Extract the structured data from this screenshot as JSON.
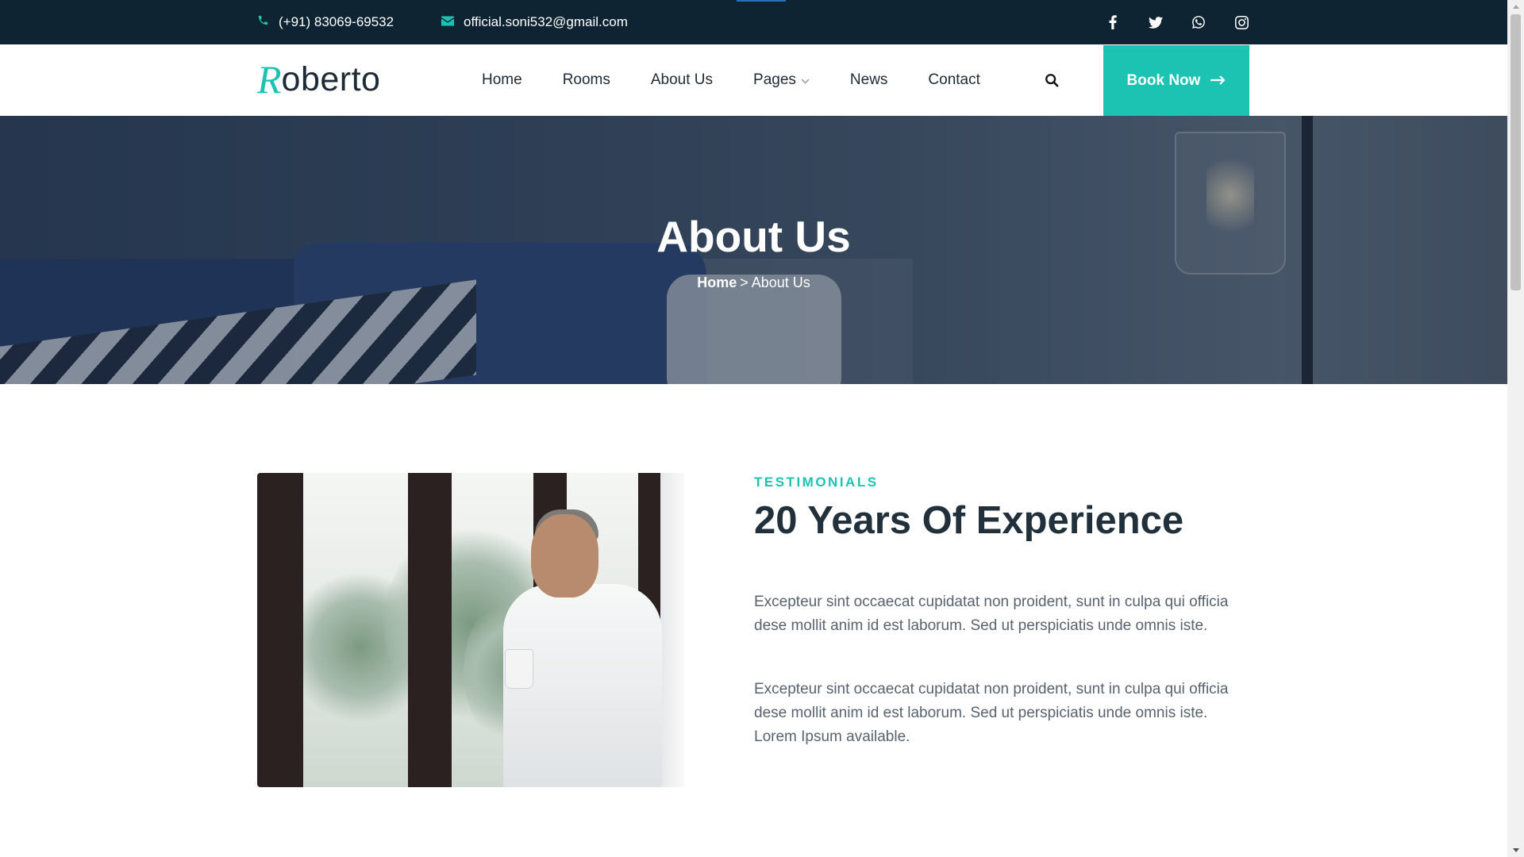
{
  "topbar": {
    "phone": "(+91) 83069-69532",
    "email": "official.soni532@gmail.com",
    "socials": [
      "facebook-icon",
      "twitter-icon",
      "whatsapp-icon",
      "instagram-icon"
    ]
  },
  "brand": {
    "logo_initial": "R",
    "logo_rest": "oberto"
  },
  "nav": {
    "items": [
      {
        "label": "Home"
      },
      {
        "label": "Rooms"
      },
      {
        "label": "About Us"
      },
      {
        "label": "Pages"
      },
      {
        "label": "News"
      },
      {
        "label": "Contact"
      }
    ],
    "book_label": "Book Now"
  },
  "hero": {
    "title": "About Us",
    "breadcrumb_home": "Home",
    "breadcrumb_sep": ">",
    "breadcrumb_current": "About Us"
  },
  "about": {
    "subtitle": "TESTIMONIALS",
    "title": "20 Years Of Experience",
    "paragraphs": [
      "Excepteur sint occaecat cupidatat non proident, sunt in culpa qui officia dese mollit anim id est laborum. Sed ut perspiciatis unde omnis iste.",
      "Excepteur sint occaecat cupidatat non proident, sunt in culpa qui officia dese mollit anim id est laborum. Sed ut perspiciatis unde omnis iste. Lorem Ipsum available."
    ]
  },
  "colors": {
    "accent": "#1cc3b2",
    "topbar_bg": "#0f2432",
    "heading": "#22303c",
    "body_text": "#58636f"
  }
}
